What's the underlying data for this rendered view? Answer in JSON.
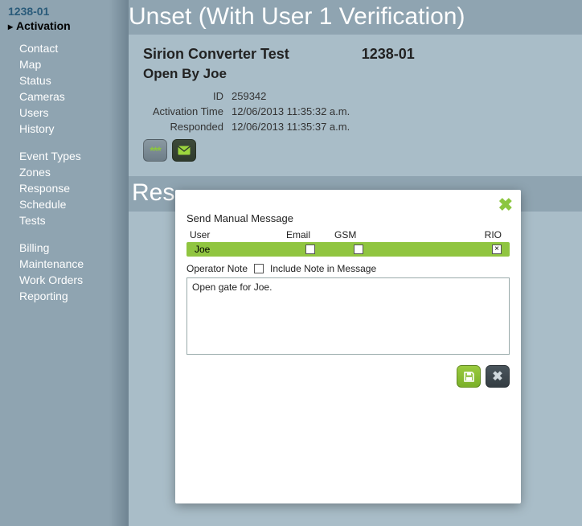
{
  "sidebar": {
    "account_id": "1238-01",
    "active": "Activation",
    "group1": [
      "Contact",
      "Map",
      "Status",
      "Cameras",
      "Users",
      "History"
    ],
    "group2": [
      "Event Types",
      "Zones",
      "Response",
      "Schedule",
      "Tests"
    ],
    "group3": [
      "Billing",
      "Maintenance",
      "Work Orders",
      "Reporting"
    ]
  },
  "banner": "Unset (With User 1 Verification)",
  "details": {
    "name": "Sirion Converter Test",
    "code": "1238-01",
    "open_by": "Open By Joe",
    "id_label": "ID",
    "id_value": "259342",
    "activation_label": "Activation Time",
    "activation_value": "12/06/2013 11:35:32 a.m.",
    "responded_label": "Responded",
    "responded_value": "12/06/2013 11:35:37 a.m."
  },
  "banner2_prefix": "Res",
  "modal": {
    "title": "Send Manual Message",
    "col_user": "User",
    "col_email": "Email",
    "col_gsm": "GSM",
    "col_rio": "RIO",
    "row_user": "Joe",
    "rio_checked": "×",
    "opnote_label": "Operator Note",
    "include_label": "Include Note in Message",
    "note_text": "Open gate for Joe."
  }
}
